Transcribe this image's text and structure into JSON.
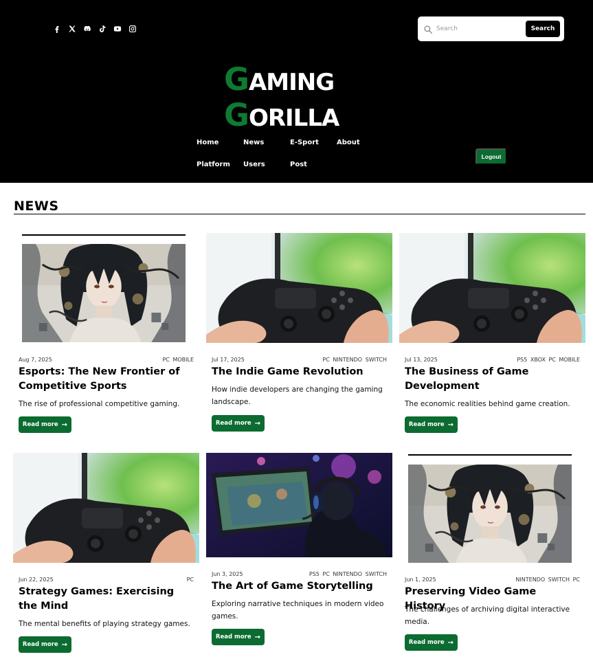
{
  "header": {
    "socials": [
      {
        "icon": "facebook-icon"
      },
      {
        "icon": "x-icon"
      },
      {
        "icon": "discord-icon"
      },
      {
        "icon": "tiktok-icon"
      },
      {
        "icon": "youtube-icon"
      },
      {
        "icon": "instagram-icon"
      }
    ],
    "search": {
      "placeholder": "Search",
      "button_label": "Search"
    },
    "logo": {
      "line1_initial": "G",
      "line1_rest": "AMING",
      "line2_initial": "G",
      "line2_rest": "ORILLA",
      "accent_color": "#0f7a33"
    },
    "nav": [
      {
        "label": "Home"
      },
      {
        "label": "News"
      },
      {
        "label": "E-Sport"
      },
      {
        "label": "About"
      },
      {
        "label": "Platform"
      },
      {
        "label": "Users"
      },
      {
        "label": "Post"
      }
    ],
    "logout_label": "Logout"
  },
  "section_title": "NEWS",
  "read_more_label": "Read more",
  "button_color": "#0c6b31",
  "articles": [
    {
      "date": "Aug 7, 2025",
      "tags": "PC MOBILE",
      "title": "Esports: The New Frontier of Competitive Sports",
      "desc": "The rise of professional competitive gaming.",
      "image": "anime-art"
    },
    {
      "date": "Jul 17, 2025",
      "tags": "PC NINTENDO SWITCH",
      "title": "The Indie Game Revolution",
      "desc": "How indie developers are changing the gaming landscape.",
      "image": "controller"
    },
    {
      "date": "Jul 13, 2025",
      "tags": "PS5 XBOX PC MOBILE",
      "title": "The Business of Game Development",
      "desc": "The economic realities behind game creation.",
      "image": "controller"
    },
    {
      "date": "Jun 22, 2025",
      "tags": "PC",
      "title": "Strategy Games: Exercising the Mind",
      "desc": "The mental benefits of playing strategy games.",
      "image": "controller"
    },
    {
      "date": "Jun 3, 2025",
      "tags": "PS5 PC NINTENDO SWITCH",
      "title": "The Art of Game Storytelling",
      "desc": "Exploring narrative techniques in modern video games.",
      "image": "gamer"
    },
    {
      "date": "Jun 1, 2025",
      "tags": "NINTENDO SWITCH PC",
      "title": "Preserving Video Game History",
      "desc": "The challenges of archiving digital interactive media.",
      "image": "anime-art"
    }
  ]
}
